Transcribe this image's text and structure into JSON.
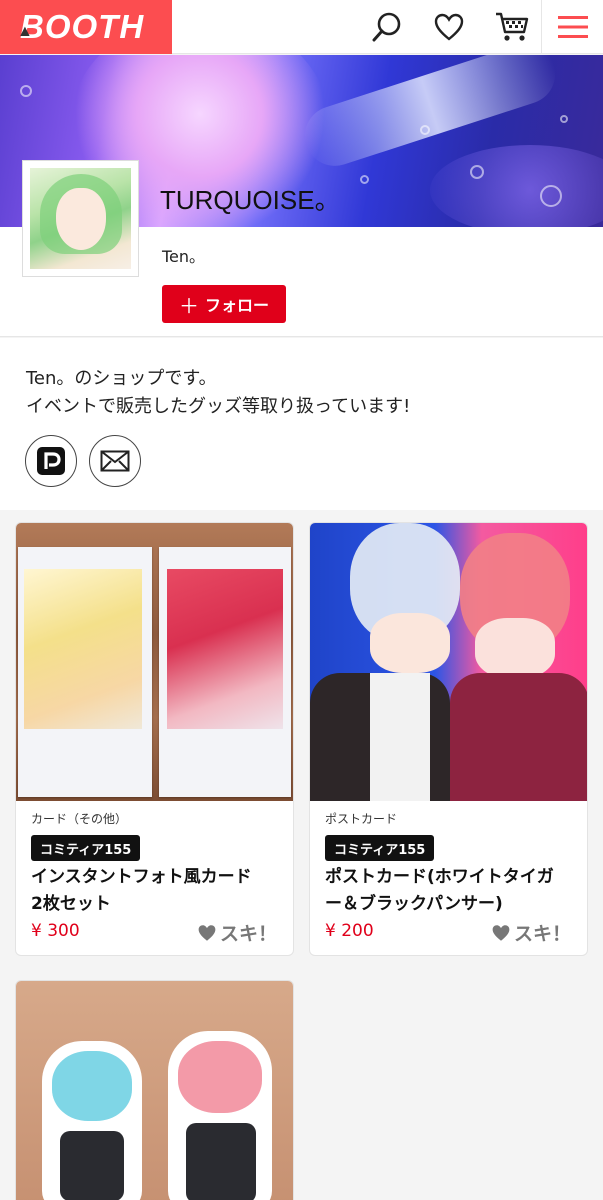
{
  "header": {
    "logo_text": "BOOTH",
    "icons": [
      "search-icon",
      "heart-icon",
      "cart-icon",
      "menu-icon"
    ],
    "brand_color": "#fc4d50"
  },
  "shop": {
    "title": "TURQUOISE。",
    "owner": "Ten。",
    "follow_label": "フォロー",
    "description_line1": "Ten。のショップです。",
    "description_line2": "イベントで販売したグッズ等取り扱っています!",
    "links": [
      "pixiv-icon",
      "mail-icon"
    ]
  },
  "products": [
    {
      "category": "カード（その他）",
      "event": "コミティア155",
      "name_line1": "インスタントフォト風カード",
      "name_line2": "2枚セット",
      "price": "¥ 300",
      "like": "スキ！"
    },
    {
      "category": "ポストカード",
      "event": "コミティア155",
      "name_line1": "ポストカード(ホワイトタイガ",
      "name_line2": "ー＆ブラックパンサー)",
      "price": "¥ 200",
      "like": "スキ！"
    }
  ],
  "colors": {
    "price": "#e0001a",
    "follow": "#e0001a",
    "event_badge": "#111111"
  }
}
